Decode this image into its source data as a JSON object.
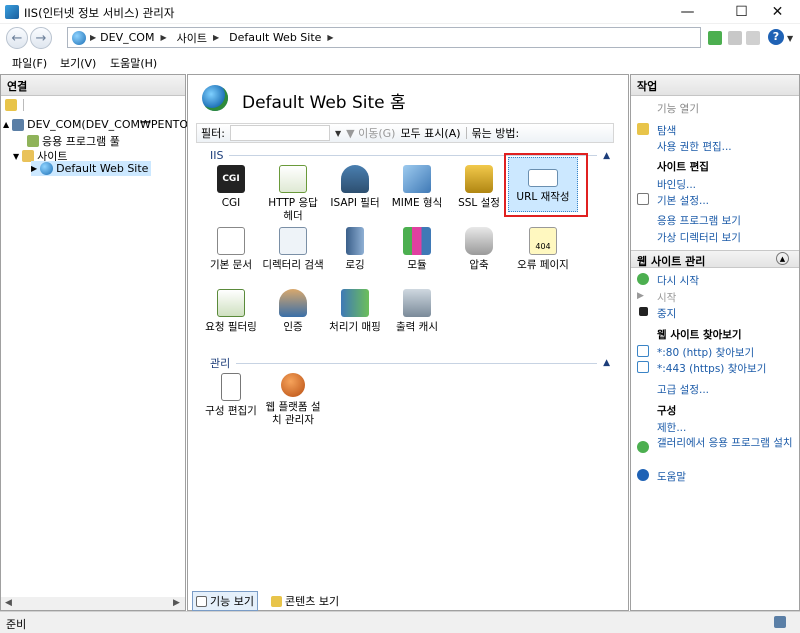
{
  "window": {
    "title": "IIS(인터넷 정보 서비스) 관리자"
  },
  "address": {
    "crumbs": [
      "DEV_COM",
      "사이트",
      "Default Web Site"
    ]
  },
  "menu": {
    "items": [
      "파일(F)",
      "보기(V)",
      "도움말(H)"
    ]
  },
  "left": {
    "header": "연결",
    "tree": {
      "server": "DEV_COM(DEV_COM₩PENTODE)",
      "apppools": "응용 프로그램 풀",
      "sites": "사이트",
      "site": "Default Web Site"
    }
  },
  "center": {
    "title": "Default Web Site 홈",
    "filter": {
      "label": "필터:",
      "go": "이동(G)",
      "showall": "모두 표시(A)",
      "groupby": "묶는 방법:"
    },
    "group_iis": "IIS",
    "group_manage": "관리",
    "features_iis": [
      {
        "label": "CGI"
      },
      {
        "label": "HTTP 응답 헤더"
      },
      {
        "label": "ISAPI 필터"
      },
      {
        "label": "MIME 형식"
      },
      {
        "label": "SSL 설정"
      },
      {
        "label": "URL 재작성"
      },
      {
        "label": "기본 문서"
      },
      {
        "label": "디렉터리 검색"
      },
      {
        "label": "로깅"
      },
      {
        "label": "모듈"
      },
      {
        "label": "압축"
      },
      {
        "label": "오류 페이지"
      },
      {
        "label": "요청 필터링"
      },
      {
        "label": "인증"
      },
      {
        "label": "처리기 매핑"
      },
      {
        "label": "출력 캐시"
      }
    ],
    "features_manage": [
      {
        "label": "구성 편집기"
      },
      {
        "label": "웹 플랫폼 설치 관리자"
      }
    ],
    "bottom": {
      "features_view": "기능 보기",
      "content_view": "콘텐츠 보기"
    },
    "cgi_icon_text": "CGI",
    "error_icon_text": "404"
  },
  "right": {
    "header": "작업",
    "open": "기능 열기",
    "explore": "탐색",
    "edit_perm": "사용 권한 편집...",
    "edit_site_head": "사이트 편집",
    "bindings": "바인딩...",
    "basic_settings": "기본 설정...",
    "view_apps": "응용 프로그램 보기",
    "view_vdirs": "가상 디렉터리 보기",
    "manage_head": "웹 사이트 관리",
    "restart": "다시 시작",
    "start": "시작",
    "stop": "중지",
    "browse_head": "웹 사이트 찾아보기",
    "browse80": "*:80 (http) 찾아보기",
    "browse443": "*:443 (https) 찾아보기",
    "advanced": "고급 설정...",
    "config_head": "구성",
    "limits": "제한...",
    "gallery": "갤러리에서 응용 프로그램 설치",
    "help": "도움말"
  },
  "status": {
    "text": "준비"
  }
}
